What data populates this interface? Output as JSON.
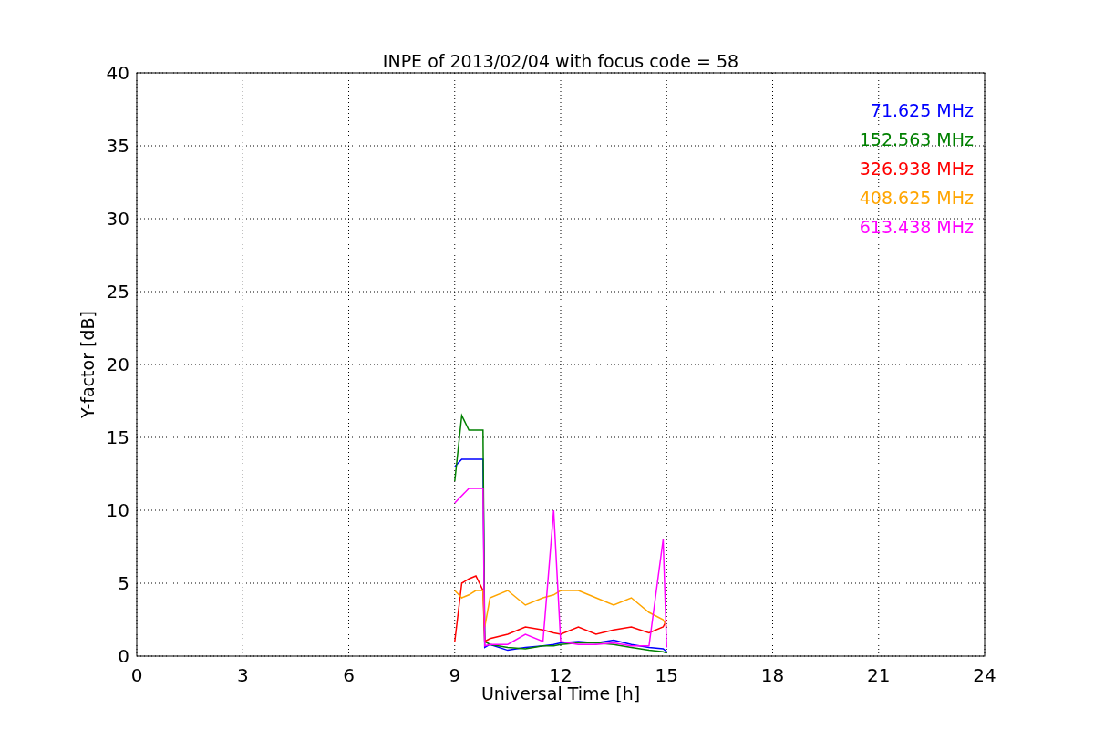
{
  "chart_data": {
    "type": "line",
    "title": "INPE of 2013/02/04 with focus code = 58",
    "xlabel": "Universal Time [h]",
    "ylabel": "Y-factor [dB]",
    "x": [
      9,
      9.2,
      9.4,
      9.6,
      9.8,
      9.85,
      10,
      10.5,
      11,
      11.5,
      11.8,
      12,
      12.5,
      13,
      13.5,
      14,
      14.5,
      14.9,
      15
    ],
    "series": [
      {
        "name": "71.625 MHz",
        "color": "#0000ff",
        "values": [
          13,
          13.5,
          13.5,
          13.5,
          13.5,
          0.6,
          0.8,
          0.4,
          0.6,
          0.7,
          0.8,
          0.9,
          1.0,
          0.9,
          1.1,
          0.8,
          0.6,
          0.5,
          0.3
        ]
      },
      {
        "name": "152.563 MHz",
        "color": "#008000",
        "values": [
          12,
          16.5,
          15.5,
          15.5,
          15.5,
          1,
          0.8,
          0.6,
          0.5,
          0.7,
          0.7,
          0.8,
          0.9,
          0.9,
          0.8,
          0.6,
          0.4,
          0.3,
          0.2
        ]
      },
      {
        "name": "326.938 MHz",
        "color": "#ff0000",
        "values": [
          1,
          5,
          5.3,
          5.5,
          4.5,
          1,
          1.2,
          1.5,
          2,
          1.8,
          1.6,
          1.5,
          2,
          1.5,
          1.8,
          2,
          1.6,
          2,
          2.5
        ]
      },
      {
        "name": "408.625 MHz",
        "color": "#ffa500",
        "values": [
          4.5,
          4,
          4.2,
          4.5,
          4.5,
          2,
          4,
          4.5,
          3.5,
          4,
          4.2,
          4.5,
          4.5,
          4,
          3.5,
          4,
          3,
          2.5,
          2
        ]
      },
      {
        "name": "613.438 MHz",
        "color": "#ff00ff",
        "values": [
          10.5,
          11,
          11.5,
          11.5,
          11.5,
          0.7,
          0.8,
          0.8,
          1.5,
          1,
          10,
          1,
          0.8,
          0.8,
          0.9,
          0.7,
          0.7,
          8,
          0.6
        ]
      }
    ],
    "xlim": [
      0,
      24
    ],
    "ylim": [
      0,
      40
    ],
    "xticks": [
      0,
      3,
      6,
      9,
      12,
      15,
      18,
      21,
      24
    ],
    "yticks": [
      0,
      5,
      10,
      15,
      20,
      25,
      30,
      35,
      40
    ],
    "grid": true
  }
}
